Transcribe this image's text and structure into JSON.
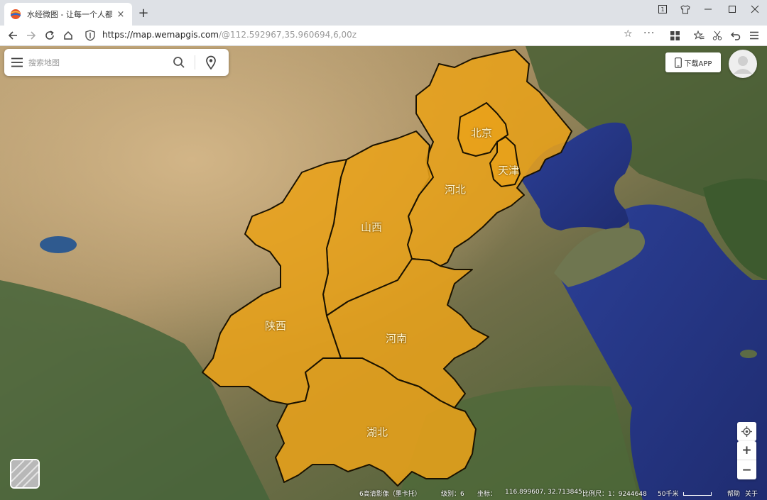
{
  "browser": {
    "tab_title": "水经微图 - 让每一个人都有自",
    "new_tab": "+",
    "tab_close": "×",
    "url_host": "https://map.wemapgis.com",
    "url_path": "/@112.592967,35.960694,6,00z",
    "win_restore_label": "1"
  },
  "search": {
    "placeholder": "搜索地图"
  },
  "header": {
    "download_label": "下载APP"
  },
  "provinces": [
    {
      "id": "beijing",
      "label": "北京"
    },
    {
      "id": "tianjin",
      "label": "天津"
    },
    {
      "id": "hebei",
      "label": "河北"
    },
    {
      "id": "shanxi",
      "label": "山西"
    },
    {
      "id": "shaanxi",
      "label": "陕西"
    },
    {
      "id": "henan",
      "label": "河南"
    },
    {
      "id": "hubei",
      "label": "湖北"
    }
  ],
  "controls": {
    "zoom_in": "+",
    "zoom_out": "−"
  },
  "status": {
    "imagery": "6高清影像（墨卡托）",
    "level": "级别：6",
    "coords_label": "坐标：",
    "coords_value": "116.899607, 32.713845",
    "scale_ratio": "比例尺：1：9244648",
    "scale_distance": "50千米",
    "help": "帮助",
    "about": "关于"
  },
  "colors": {
    "highlight_fill": "#e8a21a",
    "province_border": "#1a1200",
    "sea": "#27398a"
  }
}
